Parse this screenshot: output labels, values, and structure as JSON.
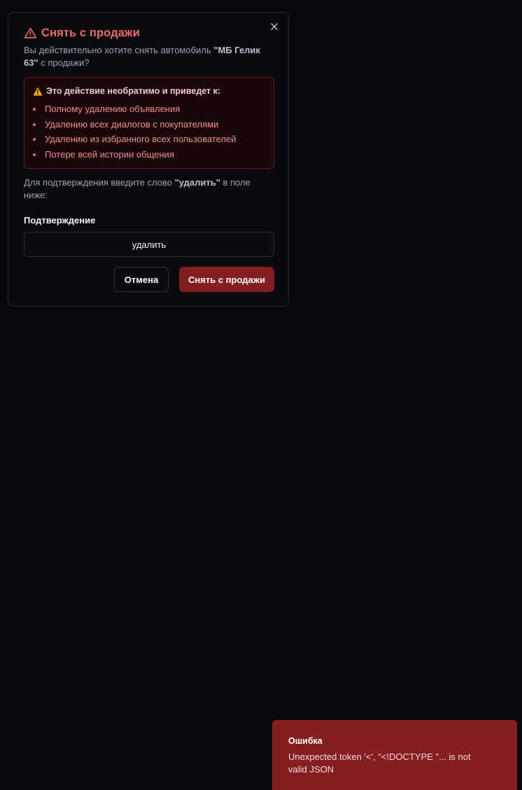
{
  "dialog": {
    "title": "Снять с продажи",
    "description": {
      "prefix": "Вы действительно хотите снять автомобиль ",
      "car_name": "\"МБ Гелик 63\"",
      "suffix": " с продажи?"
    },
    "warning": {
      "heading": "Это действие необратимо и приведет к:",
      "items": [
        "Полному удалению объявления",
        "Удалению всех диалогов с покупателями",
        "Удалению из избранного всех пользователей",
        "Потере всей истории общения"
      ]
    },
    "confirm_hint": {
      "prefix": "Для подтверждения введите слово ",
      "word": "\"удалить\"",
      "suffix": " в поле ниже:"
    },
    "confirm_label": "Подтверждение",
    "confirm_value": "удалить",
    "cancel_label": "Отмена",
    "delete_label": "Снять с продажи"
  },
  "toast": {
    "title": "Ошибка",
    "message": "Unexpected token '<', \"<!DOCTYPE \"... is not valid JSON"
  },
  "icons": {
    "close": "close-icon",
    "title": "alert-triangle-icon",
    "warning": "warning-triangle-icon"
  },
  "colors": {
    "background": "#07080c",
    "danger": "#ef6a6a",
    "danger_button": "#861d1f",
    "warning_box": "#1a0709",
    "warning_text": "#ef8f8f",
    "warning_icon": "#f5a623"
  }
}
